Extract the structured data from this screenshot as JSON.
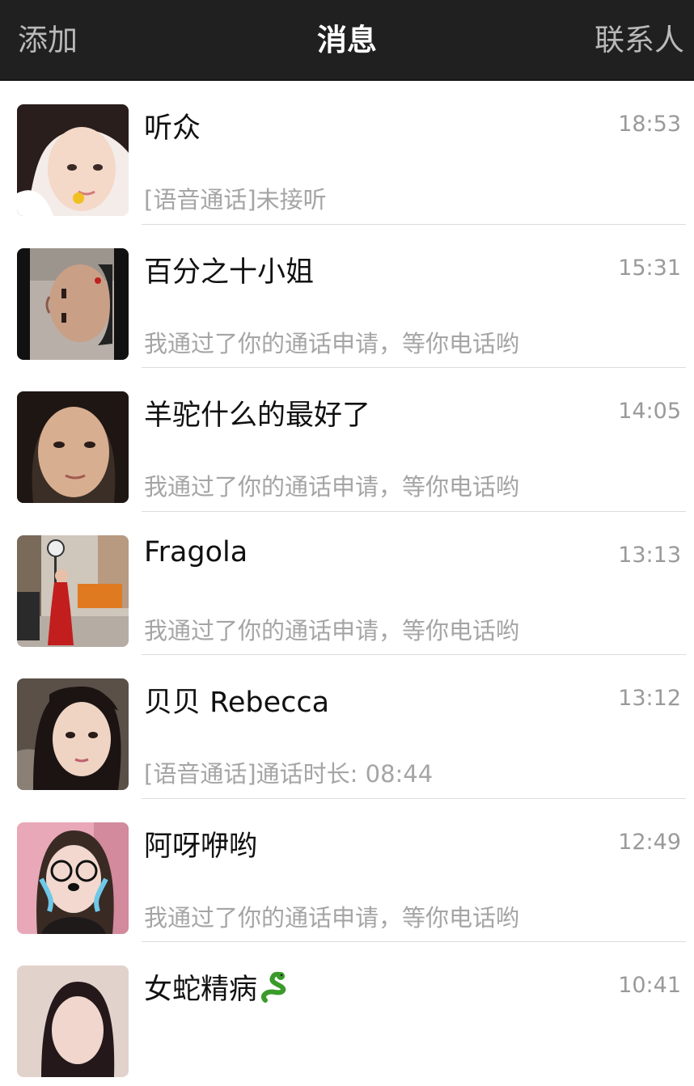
{
  "navbar": {
    "left_label": "添加",
    "title": "消息",
    "right_label": "联系人"
  },
  "conversations": [
    {
      "name": "听众",
      "time": "18:53",
      "preview": "[语音通话]未接听"
    },
    {
      "name": "百分之十小姐",
      "time": "15:31",
      "preview": "我通过了你的通话申请，等你电话哟"
    },
    {
      "name": "羊驼什么的最好了",
      "time": "14:05",
      "preview": "我通过了你的通话申请，等你电话哟"
    },
    {
      "name": "Fragola",
      "time": "13:13",
      "preview": "我通过了你的通话申请，等你电话哟"
    },
    {
      "name": "贝贝 Rebecca",
      "time": "13:12",
      "preview": "[语音通话]通话时长: 08:44"
    },
    {
      "name": "阿呀咿哟",
      "time": "12:49",
      "preview": "我通过了你的通话申请，等你电话哟"
    },
    {
      "name": "女蛇精病",
      "time": "10:41",
      "preview": ""
    }
  ],
  "icons": {
    "snake": "snake-emoji-icon"
  }
}
